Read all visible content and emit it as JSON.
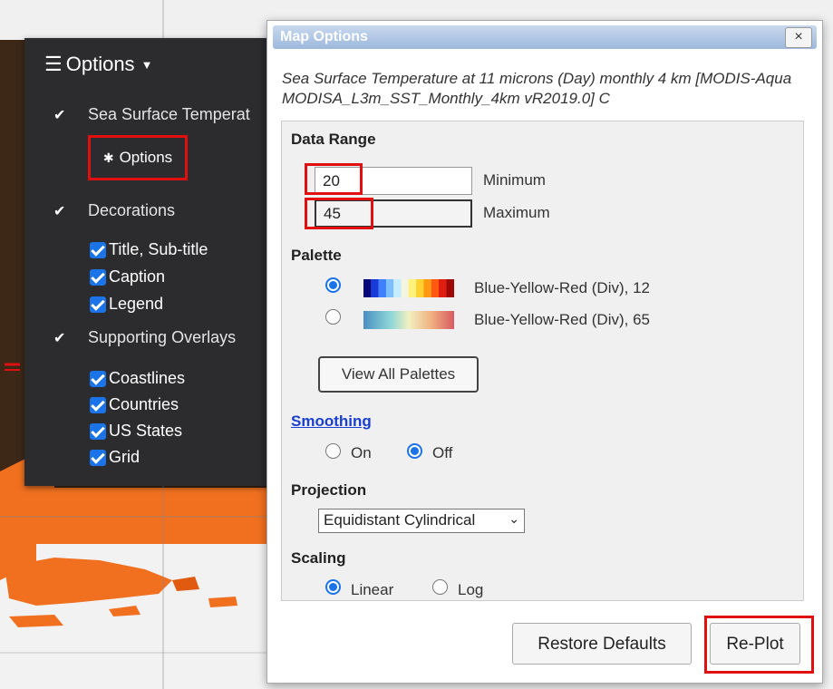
{
  "left_panel": {
    "title": "Options",
    "layer_name": "Sea Surface Temperat",
    "options_link": "Options",
    "decorations": "Decorations",
    "decoration_items": [
      "Title, Sub-title",
      "Caption",
      "Legend"
    ],
    "supporting_overlays": "Supporting Overlays",
    "overlay_items": [
      "Coastlines",
      "Countries",
      "US States",
      "Grid"
    ]
  },
  "dialog": {
    "title": "Map Options",
    "close": "×",
    "subtitle": "Sea Surface Temperature at 11 microns (Day) monthly 4 km [MODIS-Aqua MODISA_L3m_SST_Monthly_4km vR2019.0] C",
    "data_range": {
      "heading": "Data Range",
      "min_value": "20",
      "min_label": "Minimum",
      "max_value": "45",
      "max_label": "Maximum"
    },
    "palette": {
      "heading": "Palette",
      "options": [
        {
          "label": "Blue-Yellow-Red (Div), 12",
          "selected": true
        },
        {
          "label": "Blue-Yellow-Red (Div), 65",
          "selected": false
        }
      ],
      "view_all": "View All Palettes"
    },
    "smoothing": {
      "heading": "Smoothing",
      "on_label": "On",
      "off_label": "Off",
      "selected": "Off"
    },
    "projection": {
      "heading": "Projection",
      "selected": "Equidistant Cylindrical"
    },
    "scaling": {
      "heading": "Scaling",
      "linear_label": "Linear",
      "log_label": "Log",
      "selected": "Linear"
    },
    "buttons": {
      "restore": "Restore Defaults",
      "replot": "Re-Plot"
    }
  },
  "colors": {
    "map_ocean": "#f2f2f2",
    "map_land": "#3d2818",
    "map_sst": "#f07020",
    "highlight": "#e01010",
    "accent": "#1a73e8"
  }
}
